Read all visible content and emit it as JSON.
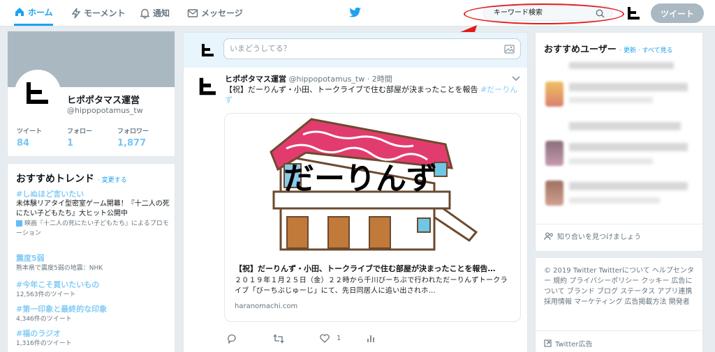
{
  "nav": {
    "home": "ホーム",
    "moments": "モーメント",
    "notifications": "通知",
    "messages": "メッセージ"
  },
  "search": {
    "placeholder": "キーワード検索"
  },
  "tweet_button": "ツイート",
  "profile": {
    "name": "ヒポポタマス運営",
    "handle": "@hippopotamus_tw",
    "stats": [
      {
        "label": "ツイート",
        "value": "84"
      },
      {
        "label": "フォロー",
        "value": "1"
      },
      {
        "label": "フォロワー",
        "value": "1,877"
      }
    ]
  },
  "trends": {
    "title": "おすすめトレンド",
    "change": "· 変更する",
    "items": [
      {
        "tag": "#しぬほど言いたい",
        "desc": "未体験リアタイ型密室ゲーム開幕！『十二人の死にたい子どもたち』大ヒット公開中",
        "meta": "映画『十二人の死にたい子どもたち』によるプロモーション"
      },
      {
        "tag": "震度5弱",
        "desc": "",
        "meta": "熊本県で震度5弱の地震：NHK"
      },
      {
        "tag": "#今年こそ買いたいもの",
        "desc": "",
        "meta": "12,563件のツイート"
      },
      {
        "tag": "#第一印象と最終的な印象",
        "desc": "",
        "meta": "4,346件のツイート"
      },
      {
        "tag": "#福のラジオ",
        "desc": "",
        "meta": "1,316件のツイート"
      }
    ]
  },
  "compose": {
    "placeholder": "いまどうしてる？"
  },
  "tweet": {
    "name": "ヒポポタマス運営",
    "handle": "@hippopotamus_tw",
    "time": "· 2時間",
    "text": "【祝】だーりんず・小田、トークライブで住む部屋が決まったことを報告 ",
    "hashtag": "#だーりんず",
    "card": {
      "image_text": "だーりんず",
      "title": "【祝】だーりんず・小田、トークライブで住む部屋が決まったことを報告…",
      "desc": "２０１９年１月２５日（金）２２時から千川びーちぶで行われただーりんずトークライブ「びーちぶじゅーじ」にて、先日同居人に追い出されホ…",
      "domain": "haranomachi.com"
    },
    "like_count": "1"
  },
  "who_to_follow": {
    "title": "おすすめユーザー",
    "links": "· 更新 · すべて見る",
    "find_friends": "知り合いを見つけましょう"
  },
  "footer": {
    "links": "© 2019 Twitter  Twitterについて  ヘルプセンター  規約  プライバシーポリシー  クッキー  広告について  ブランド  ブログ  ステータス  アプリ連携  採用情報  マーケティング  広告掲載方法  開発者",
    "ads": "Twitter広告"
  },
  "colors": {
    "accent": "#1da1f2",
    "annotation": "#e31b1b"
  }
}
